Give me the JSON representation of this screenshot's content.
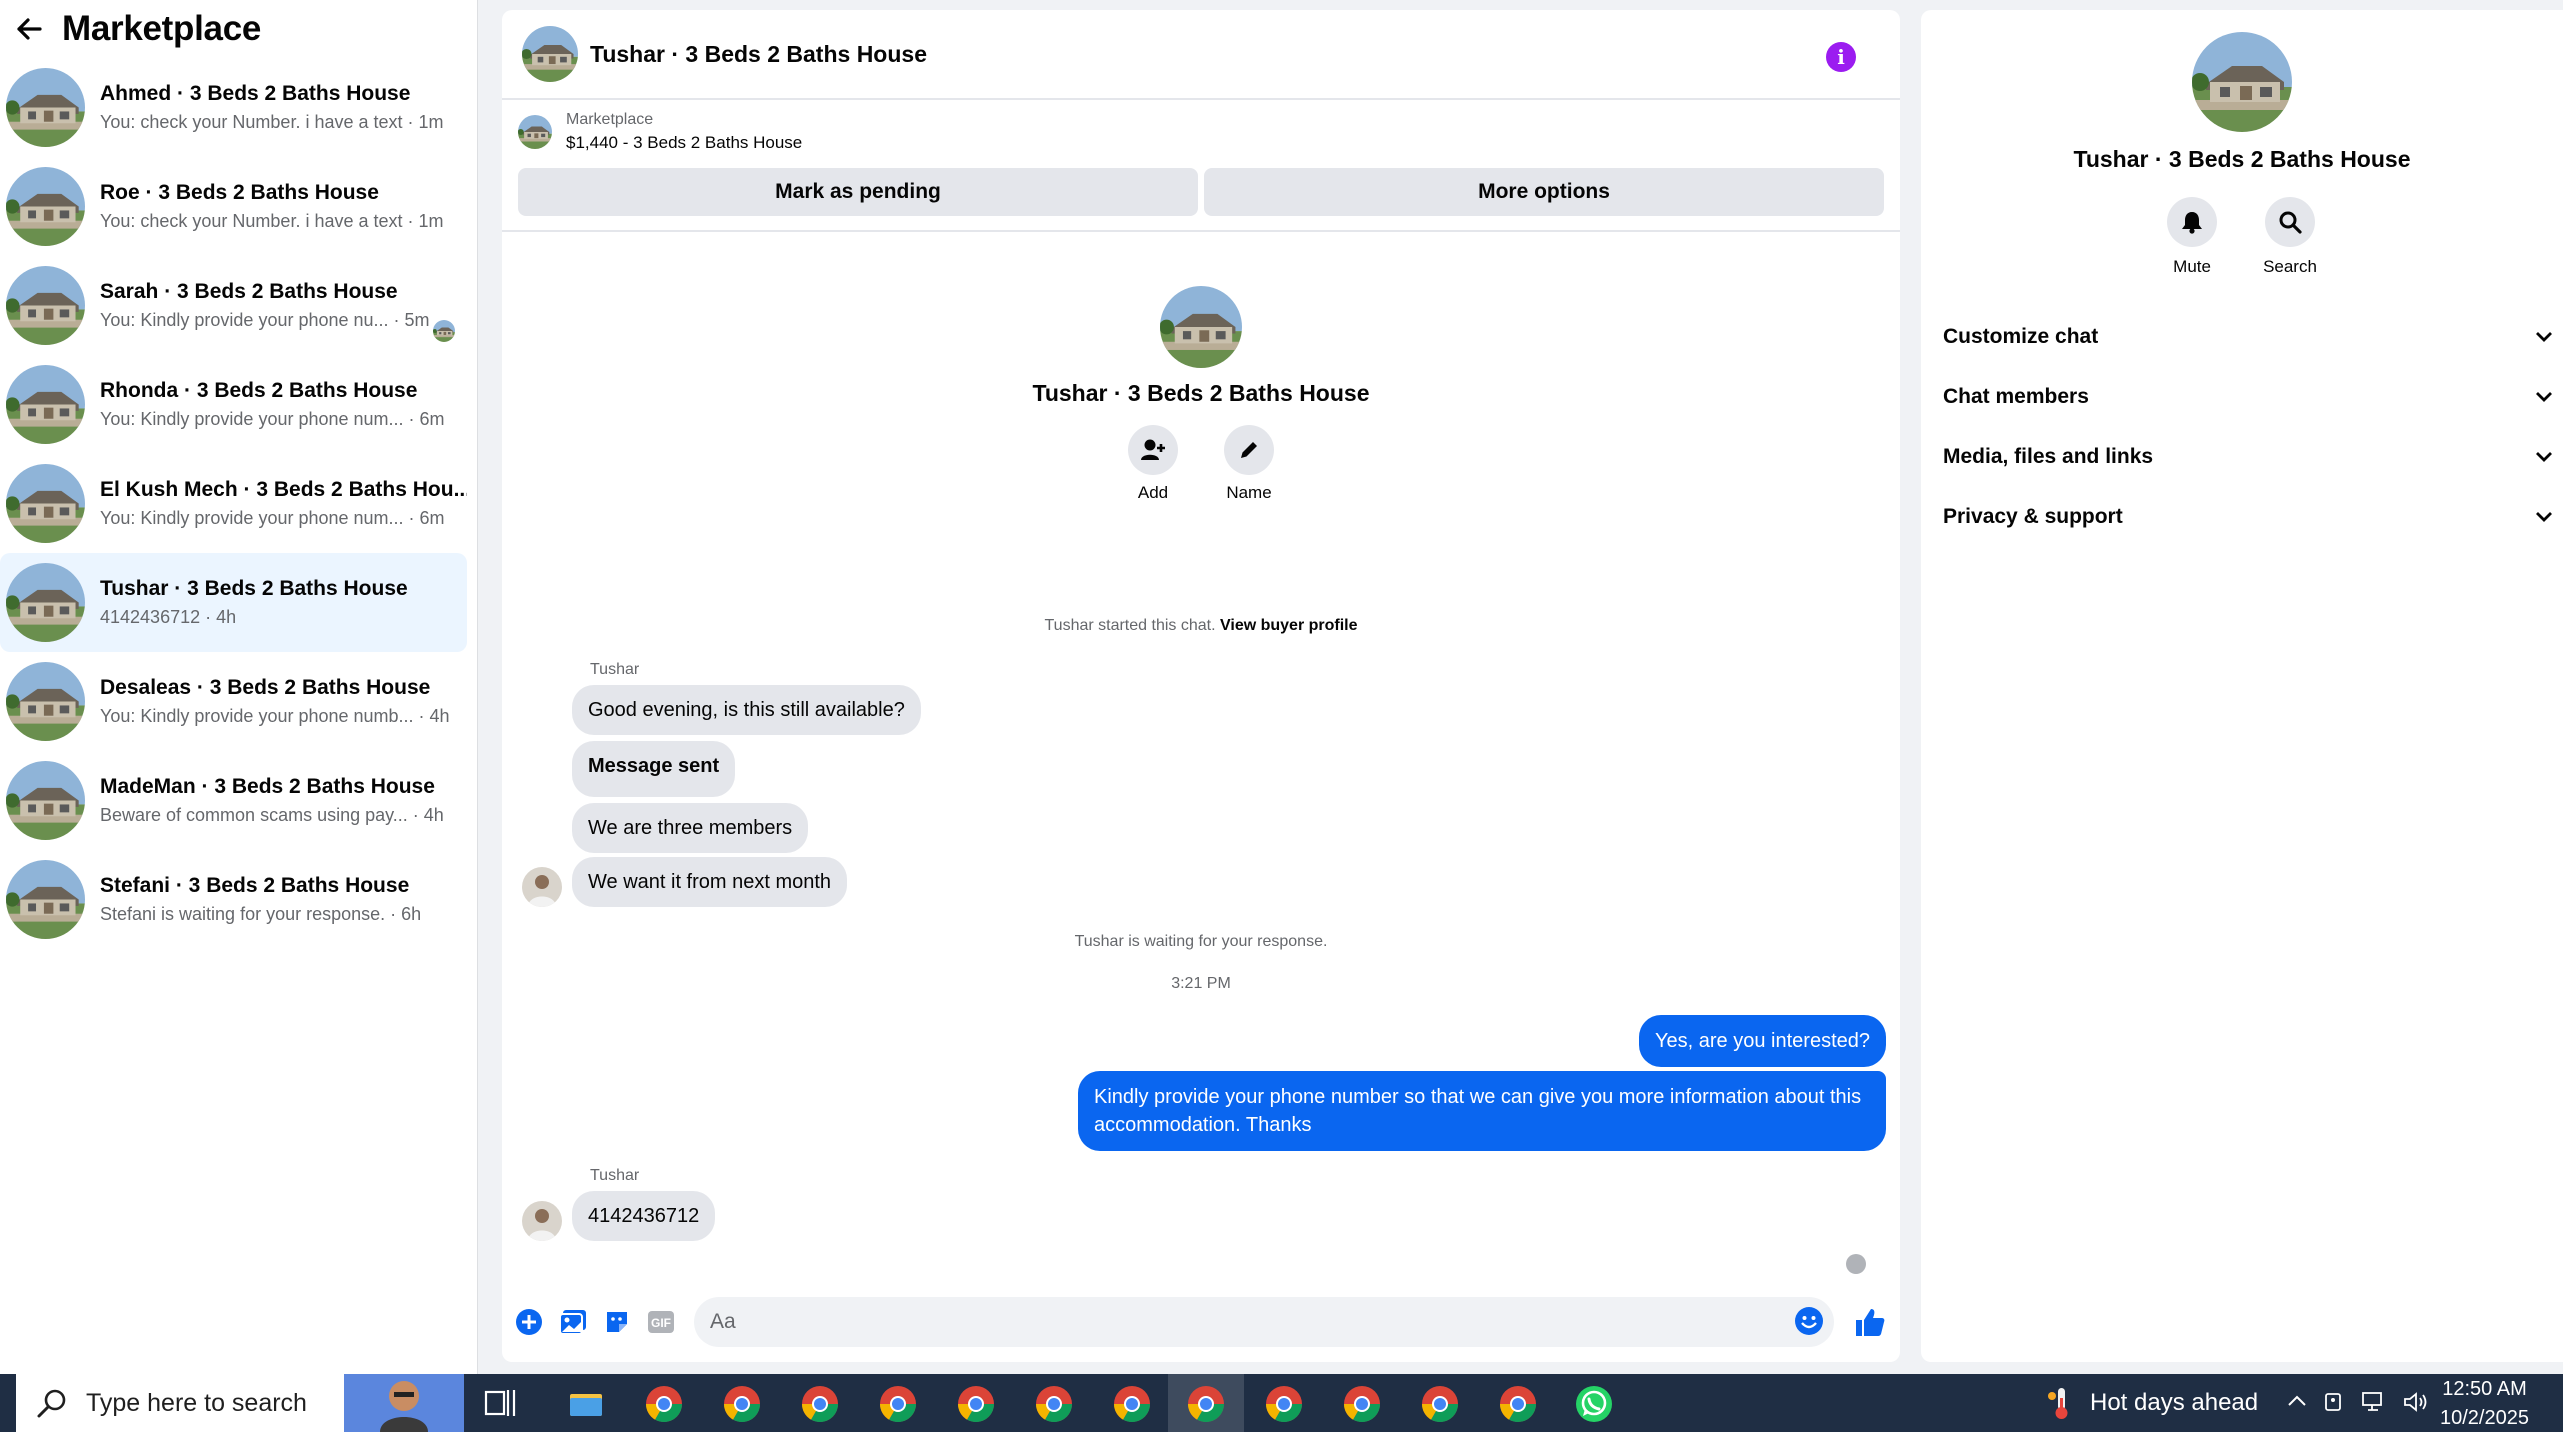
{
  "sidebar": {
    "title": "Marketplace",
    "conversations": [
      {
        "name": "Ahmed · 3 Beds 2 Baths House",
        "preview": "You: check your Number. i have a text · 1m"
      },
      {
        "name": "Roe · 3 Beds 2 Baths House",
        "preview": "You: check your Number. i have a text · 1m"
      },
      {
        "name": "Sarah · 3 Beds 2 Baths House",
        "preview": "You: Kindly provide your phone nu... · 5m"
      },
      {
        "name": "Rhonda · 3 Beds 2 Baths House",
        "preview": "You: Kindly provide your phone num... · 6m"
      },
      {
        "name": "El Kush Mech · 3 Beds 2 Baths Hou...",
        "preview": "You: Kindly provide your phone num... · 6m"
      },
      {
        "name": "Tushar · 3 Beds 2 Baths House",
        "preview": "4142436712 · 4h"
      },
      {
        "name": "Desaleas · 3 Beds 2 Baths House",
        "preview": "You: Kindly provide your phone numb... · 4h"
      },
      {
        "name": "MadeMan · 3 Beds 2 Baths House",
        "preview": "Beware of common scams using pay... · 4h"
      },
      {
        "name": "Stefani · 3 Beds 2 Baths House",
        "preview": "Stefani is waiting for your response. · 6h"
      }
    ]
  },
  "chat": {
    "title": "Tushar · 3 Beds 2 Baths House",
    "listing_label": "Marketplace",
    "listing_price": "$1,440 - 3 Beds 2 Baths House",
    "mark_pending": "Mark as pending",
    "more_options": "More options",
    "intro_title": "Tushar · 3 Beds 2 Baths House",
    "add_label": "Add",
    "name_label": "Name",
    "started_text": "Tushar started this chat.",
    "view_profile": "View buyer profile",
    "sender": "Tushar",
    "msg1": "Good evening, is this still available?",
    "msg2": "Message sent",
    "msg3": "We are three members",
    "msg4": "We want it from next month",
    "waiting": "Tushar is waiting for your response.",
    "timestamp": "3:21 PM",
    "reply1": "Yes, are you interested?",
    "reply2": "Kindly provide your phone number so that we can give you more information about this accommodation. Thanks",
    "sender2": "Tushar",
    "msg5": "4142436712",
    "composer_placeholder": "Aa"
  },
  "details": {
    "title": "Tushar · 3 Beds 2 Baths House",
    "mute": "Mute",
    "search": "Search",
    "sections": [
      "Customize chat",
      "Chat members",
      "Media, files and links",
      "Privacy & support"
    ]
  },
  "taskbar": {
    "search_placeholder": "Type here to search",
    "weather": "Hot days ahead",
    "time": "12:50 AM",
    "date": "10/2/2025"
  },
  "colors": {
    "accent": "#0a66f0",
    "info": "#9b1cf0",
    "active_row": "#ebf5ff"
  }
}
